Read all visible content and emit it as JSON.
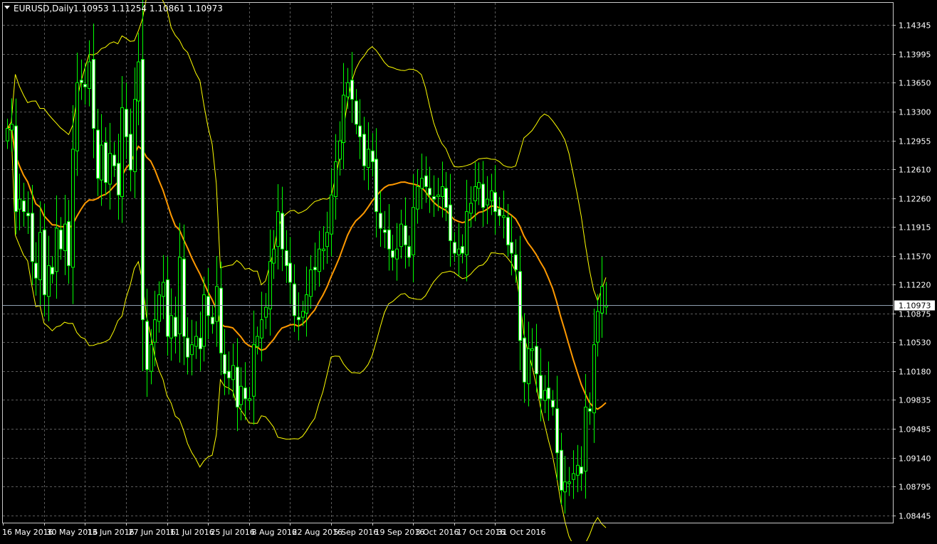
{
  "header": {
    "symbol_period": "EURUSD,Daily",
    "ohlc_text": "1.10953 1.11254 1.10861 1.10973"
  },
  "colors": {
    "background": "#000000",
    "frame": "#c8c8c8",
    "grid": "#5a5a5a",
    "bull_body": "#000000",
    "bear_body": "#ffffff",
    "bull_outline": "#00ff00",
    "bear_outline": "#00ff00",
    "wick": "#00ff00",
    "ma": "#ff9900",
    "bands": "#ffff00",
    "bid_line": "#8f9fb0",
    "text": "#ffffff"
  },
  "chart_data": {
    "type": "candlestick",
    "symbol": "EURUSD",
    "timeframe": "Daily",
    "current_price": 1.10973,
    "y_ticks": [
      1.14345,
      1.13995,
      1.1365,
      1.133,
      1.12955,
      1.1261,
      1.1226,
      1.11915,
      1.1157,
      1.1122,
      1.10875,
      1.1053,
      1.1018,
      1.09835,
      1.09485,
      1.0914,
      1.08795,
      1.08445
    ],
    "x_ticks": [
      "16 May 2016",
      "30 May 2016",
      "13 Jun 2016",
      "27 Jun 2016",
      "11 Jul 2016",
      "25 Jul 2016",
      "8 Aug 2016",
      "22 Aug 2016",
      "5 Sep 2016",
      "19 Sep 2016",
      "3 Oct 2016",
      "17 Oct 2016",
      "31 Oct 2016"
    ],
    "ylim": [
      1.0836,
      1.1461
    ],
    "grid": true,
    "close": [
      1.131,
      1.1315,
      1.121,
      1.1225,
      1.121,
      1.1205,
      1.115,
      1.113,
      1.1185,
      1.111,
      1.1145,
      1.1135,
      1.119,
      1.1165,
      1.1195,
      1.1145,
      1.1285,
      1.1365,
      1.1365,
      1.136,
      1.139,
      1.131,
      1.125,
      1.129,
      1.1245,
      1.128,
      1.1265,
      1.123,
      1.1335,
      1.13,
      1.126,
      1.1345,
      1.139,
      1.108,
      1.102,
      1.105,
      1.108,
      1.111,
      1.1125,
      1.106,
      1.1085,
      1.106,
      1.1155,
      1.106,
      1.1035,
      1.105,
      1.106,
      1.1045,
      1.111,
      1.1085,
      1.1075,
      1.112,
      1.104,
      1.1015,
      1.101,
      1.1025,
      1.0975,
      1.1,
      1.0985,
      1.0985,
      1.105,
      1.106,
      1.108,
      1.1095,
      1.115,
      1.1165,
      1.121,
      1.1165,
      1.1145,
      1.1125,
      1.1085,
      1.108,
      1.109,
      1.111,
      1.114,
      1.114,
      1.1165,
      1.1165,
      1.1185,
      1.123,
      1.127,
      1.1295,
      1.135,
      1.1365,
      1.1345,
      1.1315,
      1.13,
      1.1265,
      1.1285,
      1.127,
      1.121,
      1.119,
      1.1185,
      1.1165,
      1.1155,
      1.1165,
      1.1195,
      1.117,
      1.1155,
      1.1215,
      1.124,
      1.125,
      1.124,
      1.123,
      1.1225,
      1.123,
      1.124,
      1.1215,
      1.1175,
      1.116,
      1.1165,
      1.116,
      1.121,
      1.122,
      1.124,
      1.1245,
      1.1215,
      1.1225,
      1.1235,
      1.121,
      1.1205,
      1.1205,
      1.117,
      1.116,
      1.114,
      1.1055,
      1.1005,
      1.1045,
      1.1045,
      1.1015,
      1.0985,
      1.0995,
      1.0985,
      1.0975,
      1.092,
      1.0875,
      1.0885,
      1.0885,
      1.0895,
      1.0905,
      1.0895,
      1.0975,
      1.097,
      1.105,
      1.109,
      1.112,
      1.1097
    ]
  }
}
